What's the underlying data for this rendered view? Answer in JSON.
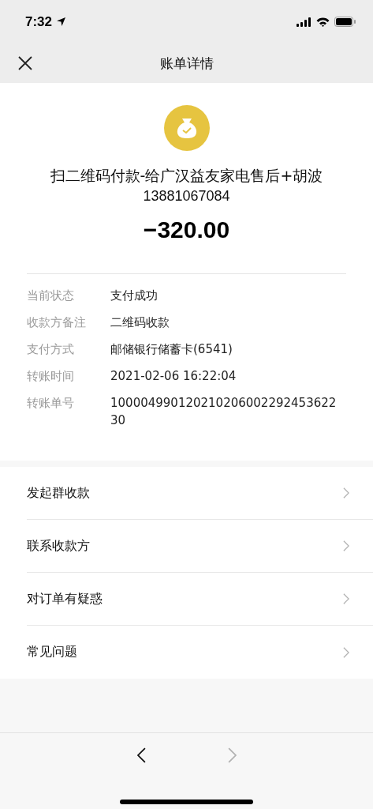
{
  "status_bar": {
    "time": "7:32"
  },
  "nav": {
    "title": "账单详情"
  },
  "summary": {
    "title": "扫二维码付款-给广汉益友家电售后+胡波",
    "subtitle": "13881067084",
    "amount": "−320.00"
  },
  "details": [
    {
      "label": "当前状态",
      "value": "支付成功"
    },
    {
      "label": "收款方备注",
      "value": "二维码收款"
    },
    {
      "label": "支付方式",
      "value": "邮储银行储蓄卡(6541)"
    },
    {
      "label": "转账时间",
      "value": "2021-02-06 16:22:04"
    },
    {
      "label": "转账单号",
      "value": "10000499012021020600229245362230"
    }
  ],
  "menu": [
    {
      "label": "发起群收款"
    },
    {
      "label": "联系收款方"
    },
    {
      "label": "对订单有疑惑"
    },
    {
      "label": "常见问题"
    }
  ],
  "browser_nav": {
    "back_disabled": false,
    "forward_disabled": true
  }
}
